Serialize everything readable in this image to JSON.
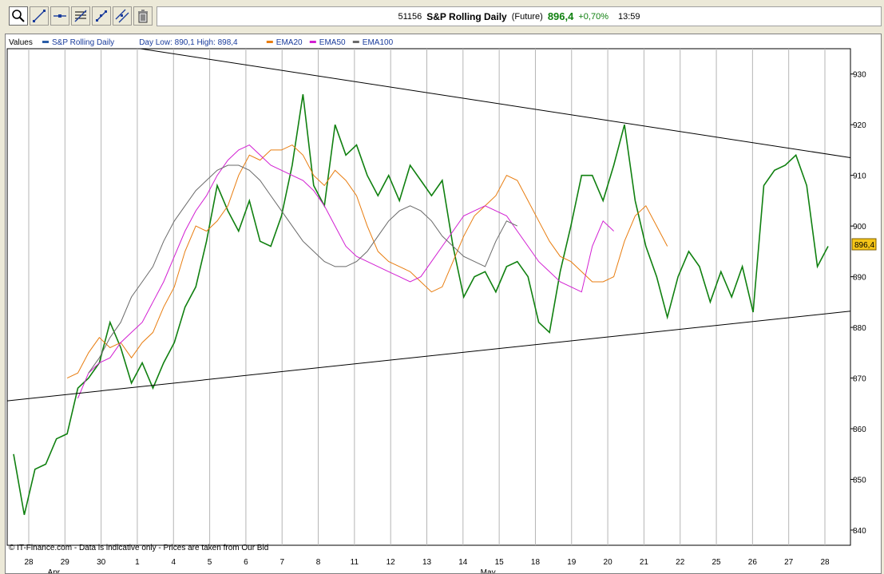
{
  "toolbar": {
    "tools": [
      {
        "name": "zoom-tool-button",
        "icon": "magnifier-icon"
      },
      {
        "name": "line-tool-button",
        "icon": "line-draw-icon"
      },
      {
        "name": "horizontal-line-tool-button",
        "icon": "horizontal-line-icon"
      },
      {
        "name": "fibonacci-tool-button",
        "icon": "fibonacci-icon"
      },
      {
        "name": "trend-tool-button",
        "icon": "trend-arrow-icon"
      },
      {
        "name": "channel-tool-button",
        "icon": "channel-icon"
      },
      {
        "name": "delete-tool-button",
        "icon": "trash-icon"
      }
    ]
  },
  "header": {
    "code": "51156",
    "name": "S&P Rolling Daily",
    "type": "(Future)",
    "price": "896,4",
    "change": "+0,70%",
    "time": "13:59"
  },
  "legend": {
    "values_label": "Values",
    "items": [
      {
        "label": "S&P Rolling Daily",
        "color": "#2b5ea8"
      },
      {
        "label": "Day Low: 890,1 High: 898,4",
        "color": ""
      },
      {
        "label": "EMA20",
        "color": "#e87d10"
      },
      {
        "label": "EMA50",
        "color": "#d21fd2"
      },
      {
        "label": "EMA100",
        "color": "#6a6a6a"
      }
    ]
  },
  "footer": {
    "copyright": "© IT-Finance.com - Data is indicative only - Prices are taken from Our Bid"
  },
  "chart_data": {
    "type": "line",
    "ylim": [
      837,
      935
    ],
    "y_ticks": [
      840,
      850,
      860,
      870,
      880,
      890,
      900,
      910,
      920,
      930
    ],
    "x_tick_labels": [
      "28",
      "29",
      "30",
      "1",
      "4",
      "5",
      "6",
      "7",
      "8",
      "11",
      "12",
      "13",
      "14",
      "15",
      "18",
      "19",
      "20",
      "21",
      "22",
      "25",
      "26",
      "27",
      "28"
    ],
    "month_labels": [
      {
        "label": "Apr",
        "index": 1
      },
      {
        "label": "May",
        "index": 13
      }
    ],
    "last_price_label": "896,4",
    "grid": "vertical",
    "series": [
      {
        "name": "S&P Rolling Daily",
        "color": "#108010",
        "values": [
          855,
          843,
          852,
          853,
          858,
          859,
          868,
          870,
          873,
          881,
          876,
          869,
          873,
          868,
          873,
          877,
          884,
          888,
          897,
          908,
          903,
          899,
          905,
          897,
          896,
          902,
          912,
          926,
          908,
          904,
          920,
          914,
          916,
          910,
          906,
          910,
          905,
          912,
          909,
          906,
          909,
          896,
          886,
          890,
          891,
          887,
          892,
          893,
          890,
          881,
          879,
          891,
          900,
          910,
          910,
          905,
          912,
          920,
          905,
          896,
          890,
          882,
          890,
          895,
          892,
          885,
          891,
          886,
          892,
          883,
          908,
          911,
          912,
          914,
          908,
          892,
          896
        ]
      },
      {
        "name": "EMA20",
        "color": "#e87d10",
        "values": [
          null,
          null,
          null,
          null,
          null,
          870,
          871,
          875,
          878,
          876,
          877,
          874,
          877,
          879,
          884,
          888,
          895,
          900,
          899,
          901,
          904,
          910,
          914,
          913,
          915,
          915,
          916,
          914,
          910,
          908,
          911,
          909,
          906,
          900,
          895,
          893,
          892,
          891,
          889,
          887,
          888,
          893,
          898,
          902,
          904,
          906,
          910,
          909,
          905,
          901,
          897,
          894,
          893,
          891,
          889,
          889,
          890,
          897,
          902,
          904,
          900,
          896
        ]
      },
      {
        "name": "EMA50",
        "color": "#d21fd2",
        "values": [
          null,
          null,
          null,
          null,
          null,
          null,
          866,
          871,
          873,
          874,
          877,
          879,
          881,
          885,
          889,
          894,
          899,
          903,
          906,
          910,
          913,
          915,
          916,
          914,
          912,
          911,
          910,
          909,
          907,
          904,
          900,
          896,
          894,
          893,
          892,
          891,
          890,
          889,
          890,
          893,
          896,
          899,
          902,
          903,
          904,
          903,
          902,
          899,
          896,
          893,
          891,
          889,
          888,
          887,
          896,
          901,
          899
        ]
      },
      {
        "name": "EMA100",
        "color": "#6a6a6a",
        "values": [
          null,
          null,
          null,
          null,
          null,
          null,
          null,
          871,
          874,
          878,
          881,
          886,
          889,
          892,
          897,
          901,
          904,
          907,
          909,
          911,
          912,
          912,
          911,
          909,
          906,
          903,
          900,
          897,
          895,
          893,
          892,
          892,
          893,
          895,
          898,
          901,
          903,
          904,
          903,
          901,
          898,
          896,
          894,
          893,
          892,
          897,
          901,
          900
        ]
      }
    ],
    "trendlines": [
      {
        "name": "resistance",
        "from": [
          0.158,
          935
        ],
        "to": [
          1.0,
          913.5
        ]
      },
      {
        "name": "support",
        "from": [
          0.0,
          865.5
        ],
        "to": [
          1.0,
          883.2
        ]
      }
    ]
  }
}
